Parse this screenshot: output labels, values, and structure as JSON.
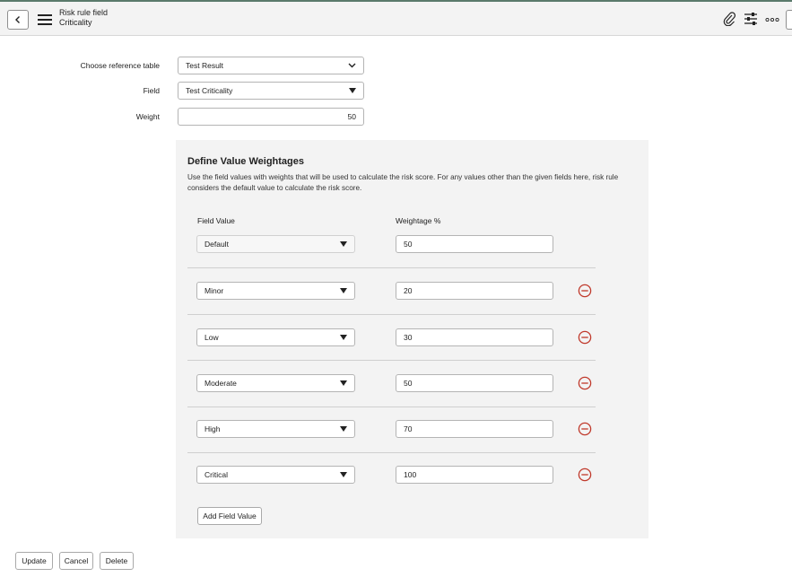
{
  "header": {
    "line1": "Risk rule field",
    "line2": "Criticality"
  },
  "form": {
    "reference_table_label": "Choose reference table",
    "reference_table_value": "Test Result",
    "field_label": "Field",
    "field_value": "Test Criticality",
    "weight_label": "Weight",
    "weight_value": "50"
  },
  "panel": {
    "title": "Define Value Weightages",
    "description": "Use the field values with weights that will be used to calculate the risk score. For any values other than the given fields here, risk rule considers the default value to calculate the risk score.",
    "col_field_value": "Field Value",
    "col_weightage": "Weightage %",
    "rows": [
      {
        "field": "Default",
        "weight": "50"
      },
      {
        "field": "Minor",
        "weight": "20"
      },
      {
        "field": "Low",
        "weight": "30"
      },
      {
        "field": "Moderate",
        "weight": "50"
      },
      {
        "field": "High",
        "weight": "70"
      },
      {
        "field": "Critical",
        "weight": "100"
      }
    ],
    "add_button": "Add Field Value"
  },
  "footer": {
    "update": "Update",
    "cancel": "Cancel",
    "delete": "Delete"
  },
  "colors": {
    "accent_line": "#5a7a6b",
    "remove_icon": "#c0392b",
    "panel_bg": "#f3f3f3"
  },
  "icons": [
    "chevron-left-icon",
    "hamburger-menu-icon",
    "paperclip-icon",
    "sliders-icon",
    "more-options-icon",
    "chevron-down-icon",
    "triangle-down-icon",
    "remove-circle-icon"
  ]
}
